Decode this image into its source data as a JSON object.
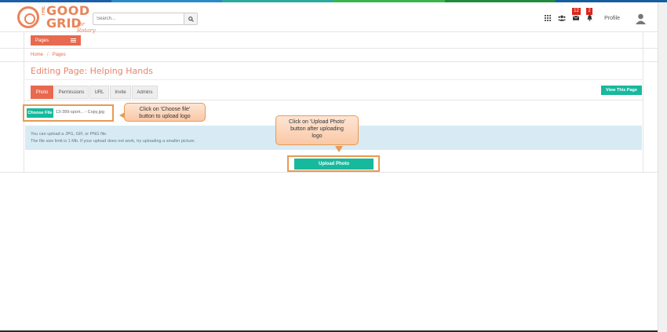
{
  "top_stripe_colors": [
    "#1a5fa8",
    "#2b8ac6",
    "#2aa9a0",
    "#3bb54a",
    "#1f8a3a",
    "#145ea0"
  ],
  "brand": {
    "logo_the": "THE",
    "logo_good": "GOOD",
    "logo_grid": "GRID",
    "logo_for": "for Rotary"
  },
  "search": {
    "placeholder": "Search..."
  },
  "header": {
    "messages_badge": "12",
    "notifications_badge": "2",
    "profile_label": "Profile"
  },
  "sidebar": {
    "pages_label": "Pages"
  },
  "breadcrumb": {
    "home": "Home",
    "sep": "/",
    "current": "Pages"
  },
  "page_title": "Editing Page: Helping Hands",
  "tabs": [
    "Photo",
    "Permissions",
    "URL",
    "Invite",
    "Admins"
  ],
  "active_tab": "Photo",
  "view_page_button": "View This Page",
  "file_input": {
    "button_label": "Choose File",
    "file_name": "13-399-sport... - Copy.jpg"
  },
  "callouts": {
    "choose_file_line1": "Click on 'Choose file'",
    "choose_file_line2": "button to upload logo",
    "upload_line1": "Click on 'Upload Photo'",
    "upload_line2": "button after uploading",
    "upload_line3": "logo"
  },
  "info": {
    "line1": "You can upload a JPG, GIF, or PNG file.",
    "line2": "The file size limit is 1 Mb. If your upload does not work, try uploading a smaller picture."
  },
  "upload_button": "Upload Photo",
  "colors": {
    "accent": "#e8694f",
    "teal": "#17b99d",
    "highlight_border": "#e79a54",
    "info_bg": "#d8ebf4",
    "badge": "#d9261c"
  }
}
